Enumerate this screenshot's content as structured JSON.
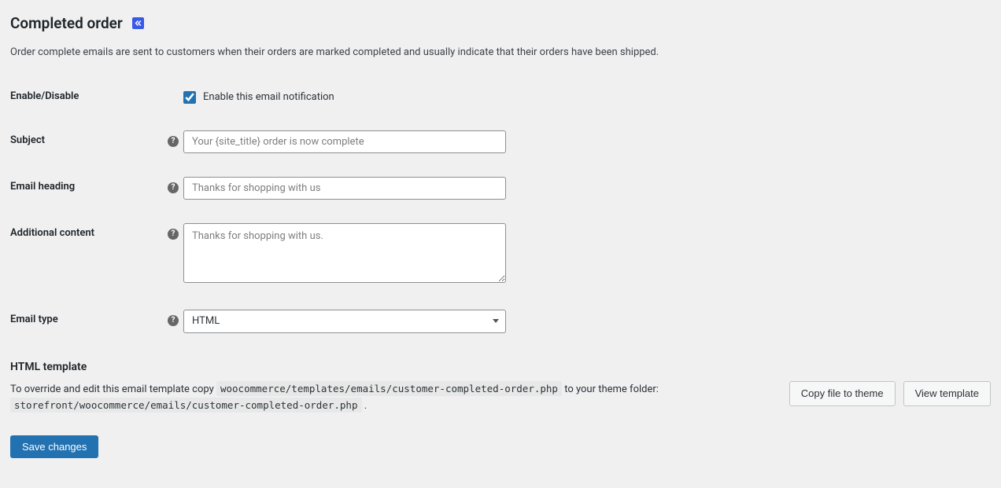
{
  "header": {
    "title": "Completed order",
    "description": "Order complete emails are sent to customers when their orders are marked completed and usually indicate that their orders have been shipped."
  },
  "fields": {
    "enable": {
      "label": "Enable/Disable",
      "checkbox_label": "Enable this email notification",
      "checked": true
    },
    "subject": {
      "label": "Subject",
      "placeholder": "Your {site_title} order is now complete",
      "value": ""
    },
    "heading": {
      "label": "Email heading",
      "placeholder": "Thanks for shopping with us",
      "value": ""
    },
    "additional": {
      "label": "Additional content",
      "placeholder": "Thanks for shopping with us.",
      "value": ""
    },
    "email_type": {
      "label": "Email type",
      "selected": "HTML"
    }
  },
  "template": {
    "section_label": "HTML template",
    "intro_text": "To override and edit this email template copy ",
    "source_path": "woocommerce/templates/emails/customer-completed-order.php",
    "middle_text": " to your theme folder: ",
    "dest_path": "storefront/woocommerce/emails/customer-completed-order.php",
    "end_text": " .",
    "copy_button": "Copy file to theme",
    "view_button": "View template"
  },
  "actions": {
    "save": "Save changes"
  }
}
